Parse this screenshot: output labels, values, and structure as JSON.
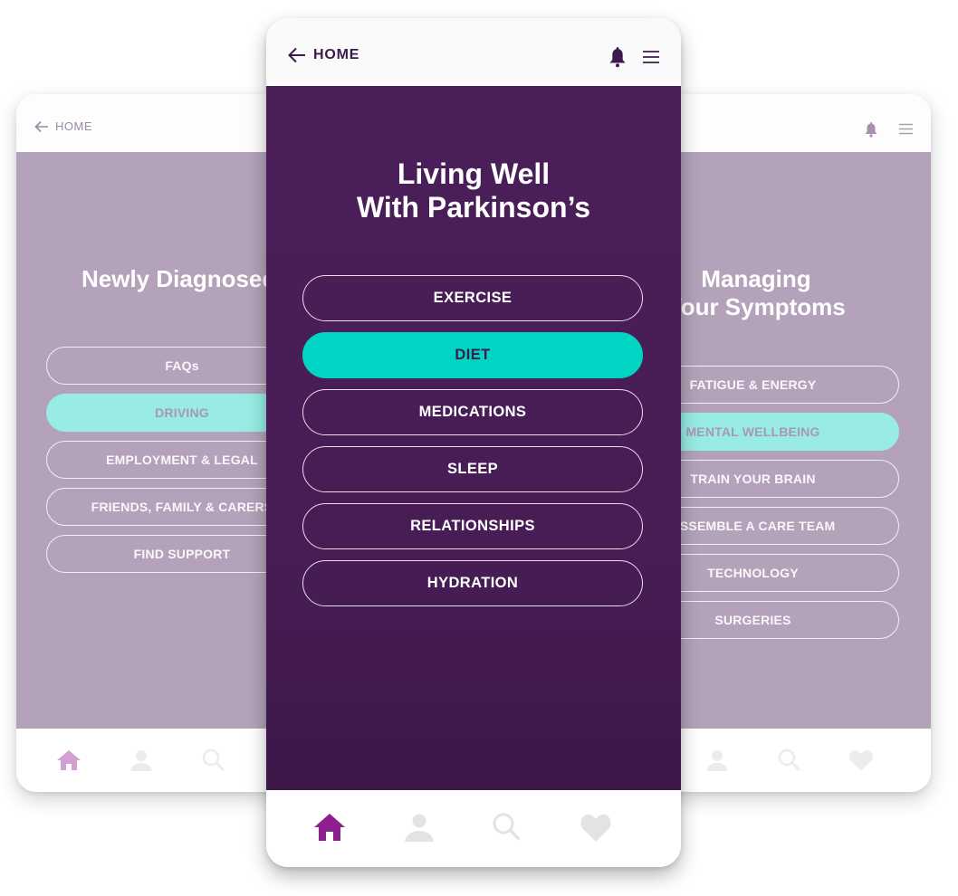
{
  "colors": {
    "center_primary": "#4a1e58",
    "accent_teal": "#00d5c4",
    "faded_body": "#b3a2b9",
    "faded_teal": "#98ece4",
    "nav_active": "#8e1f8f",
    "nav_inactive": "#e3e3e3"
  },
  "left_card": {
    "back_label": "HOME",
    "back_icon": "arrow-left-icon",
    "title": "Newly Diagnosed",
    "items": [
      {
        "label": "FAQs",
        "active": false
      },
      {
        "label": "DRIVING",
        "active": true
      },
      {
        "label": "EMPLOYMENT & LEGAL",
        "active": false
      },
      {
        "label": "FRIENDS, FAMILY & CARERS",
        "active": false
      },
      {
        "label": "FIND SUPPORT",
        "active": false
      }
    ],
    "nav": [
      "home-icon",
      "user-icon",
      "search-icon"
    ]
  },
  "center_card": {
    "back_label": "HOME",
    "back_icon": "arrow-left-icon",
    "bell_icon": "bell-icon",
    "menu_icon": "hamburger-menu-icon",
    "title_line1": "Living Well",
    "title_line2": "With Parkinson’s",
    "items": [
      {
        "label": "EXERCISE",
        "active": false
      },
      {
        "label": "DIET",
        "active": true
      },
      {
        "label": "MEDICATIONS",
        "active": false
      },
      {
        "label": "SLEEP",
        "active": false
      },
      {
        "label": "RELATIONSHIPS",
        "active": false
      },
      {
        "label": "HYDRATION",
        "active": false
      }
    ],
    "nav": [
      "home-icon",
      "user-icon",
      "search-icon",
      "heart-icon"
    ],
    "nav_active": "home-icon"
  },
  "right_card": {
    "title_line1": "Managing",
    "title_line2": "Your Symptoms",
    "bell_icon": "bell-icon",
    "menu_icon": "hamburger-menu-icon",
    "items": [
      {
        "label": "FATIGUE & ENERGY",
        "active": false
      },
      {
        "label": "MENTAL WELLBEING",
        "active": true
      },
      {
        "label": "TRAIN YOUR BRAIN",
        "active": false
      },
      {
        "label": "ASSEMBLE A CARE TEAM",
        "active": false
      },
      {
        "label": "TECHNOLOGY",
        "active": false
      },
      {
        "label": "SURGERIES",
        "active": false
      }
    ],
    "nav": [
      "user-icon",
      "search-icon",
      "heart-icon"
    ]
  }
}
